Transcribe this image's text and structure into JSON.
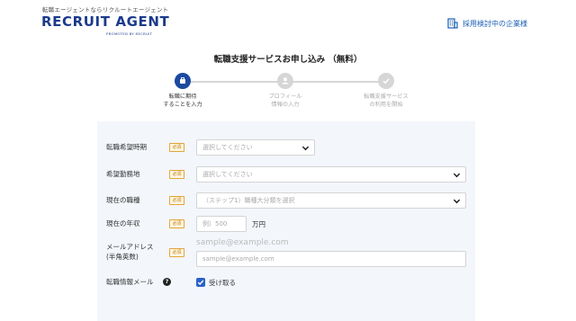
{
  "header": {
    "tagline": "転職エージェントならリクルートエージェント",
    "logo": "RECRUIT AGENT",
    "logo_sub": "PROMOTED BY RECRUIT",
    "corp_link": "採用検討中の企業様",
    "corp_icon": "building-icon"
  },
  "page": {
    "title": "転職支援サービスお申し込み （無料）"
  },
  "steps": [
    {
      "label_line1": "転職に期待",
      "label_line2": "することを入力",
      "state": "active"
    },
    {
      "label_line1": "プロフィール",
      "label_line2": "情報の入力",
      "state": "inactive"
    },
    {
      "label_line1": "転職支援サービス",
      "label_line2": "の利用を開始",
      "state": "inactive"
    }
  ],
  "form": {
    "required_badge": "必須",
    "timing": {
      "label": "転職希望時期",
      "placeholder": "選択してください"
    },
    "location": {
      "label": "希望勤務地",
      "placeholder": "選択してください"
    },
    "job": {
      "label": "現在の職種",
      "placeholder": "（ステップ1）職種大分類を選択"
    },
    "income": {
      "label": "現在の年収",
      "placeholder": "例）500",
      "unit": "万円"
    },
    "email": {
      "label_line1": "メールアドレス",
      "label_line2": "(半角英数)",
      "example": "sample@example.com",
      "placeholder": "sample@example.com"
    },
    "newsletter": {
      "label": "転職情報メール",
      "help": "?",
      "checkbox_label": "受け取る",
      "checked": true
    }
  },
  "colors": {
    "brand": "#1a3a8c",
    "accent": "#2a62c9",
    "badge": "#e3a43a"
  }
}
